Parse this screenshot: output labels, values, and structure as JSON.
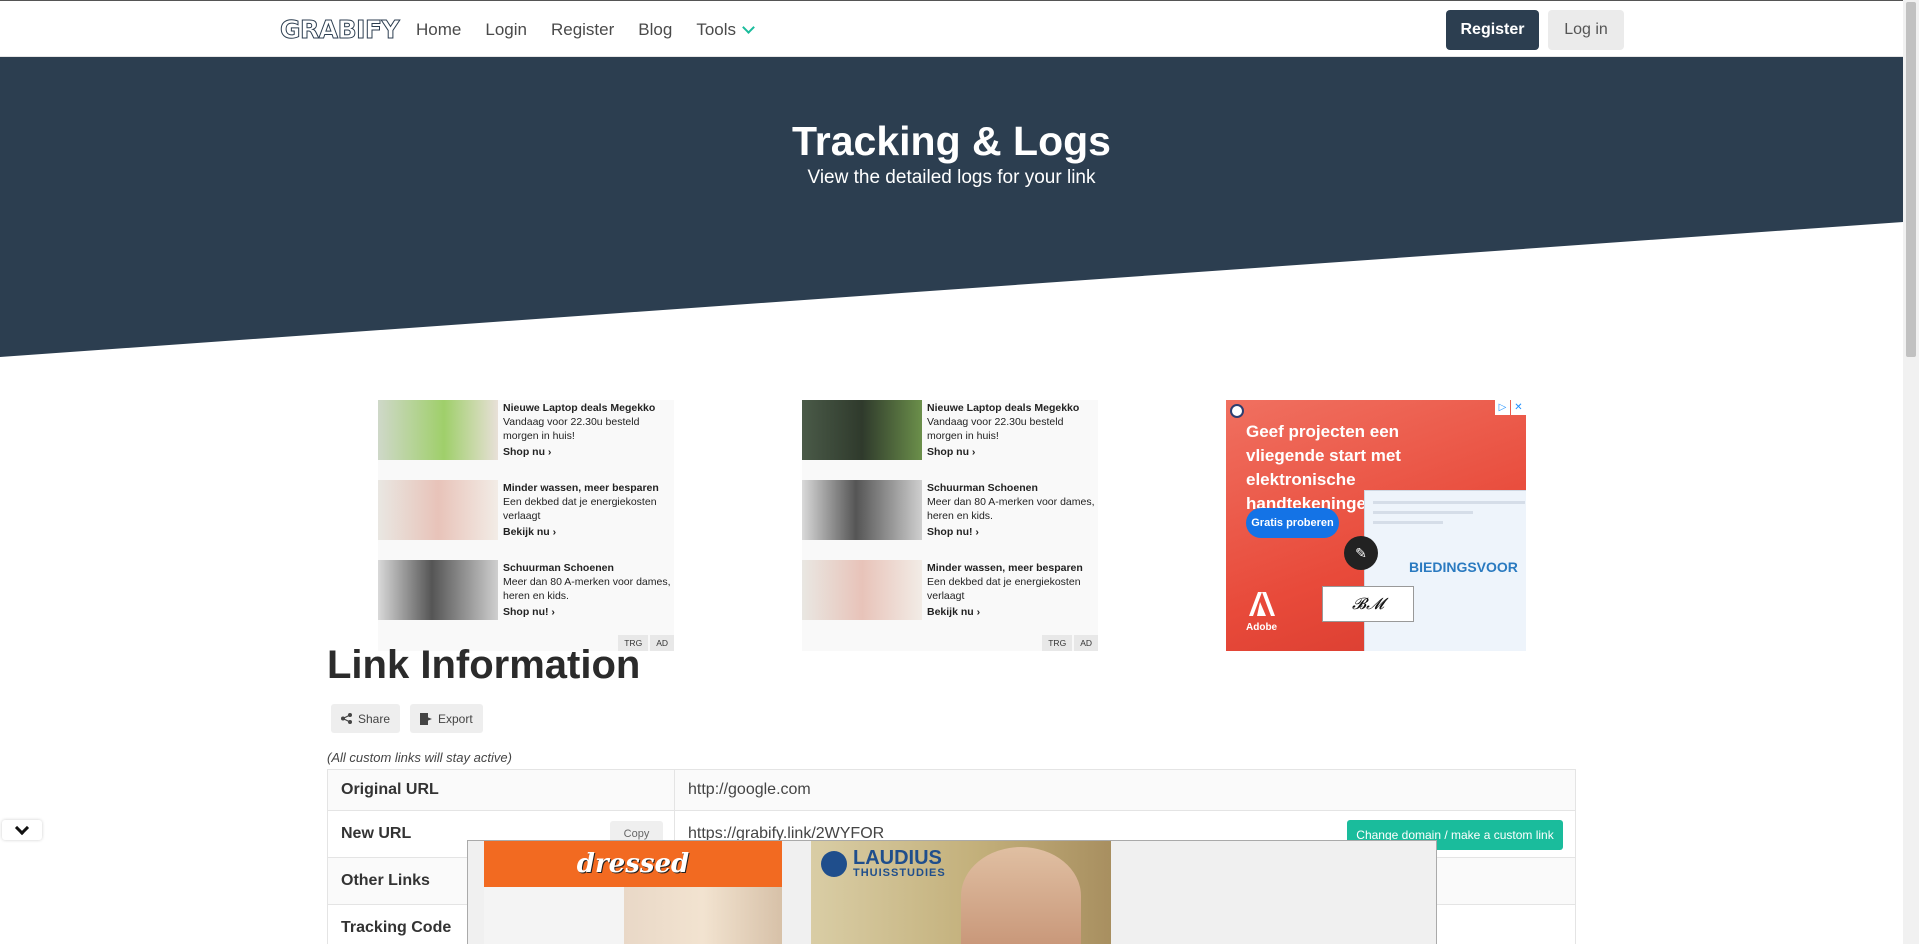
{
  "nav": {
    "logo": "GRABIFY",
    "links": [
      "Home",
      "Login",
      "Register",
      "Blog",
      "Tools"
    ],
    "register_btn": "Register",
    "login_btn": "Log in"
  },
  "hero": {
    "title": "Tracking & Logs",
    "subtitle": "View the detailed logs for your link",
    "bg_color": "#2c3e50"
  },
  "ads": {
    "native_left": {
      "items": [
        {
          "title": "Nieuwe Laptop deals Megekko",
          "desc": "Vandaag voor 22.30u besteld morgen in huis!",
          "cta": "Shop nu"
        },
        {
          "title": "Minder wassen, meer besparen",
          "desc": "Een dekbed dat je energiekosten verlaagt",
          "cta": "Bekijk nu"
        },
        {
          "title": "Schuurman Schoenen",
          "desc": "Meer dan 80 A-merken voor dames, heren en kids.",
          "cta": "Shop nu!"
        }
      ],
      "tags": [
        "TRG",
        "AD"
      ]
    },
    "native_middle": {
      "items": [
        {
          "title": "Nieuwe Laptop deals Megekko",
          "desc": "Vandaag voor 22.30u besteld morgen in huis!",
          "cta": "Shop nu"
        },
        {
          "title": "Schuurman Schoenen",
          "desc": "Meer dan 80 A-merken voor dames, heren en kids.",
          "cta": "Shop nu!"
        },
        {
          "title": "Minder wassen, meer besparen",
          "desc": "Een dekbed dat je energiekosten verlaagt",
          "cta": "Bekijk nu"
        }
      ],
      "tags": [
        "TRG",
        "AD"
      ]
    },
    "adobe": {
      "headline": "Geef projecten een vliegende start met elektronische handtekeningen.",
      "button": "Gratis proberen",
      "doc_word": "BIEDINGSVOOR",
      "brand": "Adobe"
    },
    "sticky": {
      "ad1_brand": "dressed",
      "ad2_brand": "LAUDIUS",
      "ad2_sub": "THUISSTUDIES"
    }
  },
  "link_info": {
    "title": "Link Information",
    "share_btn": "Share",
    "export_btn": "Export",
    "note": "(All custom links will stay active)",
    "rows": [
      {
        "label": "Original URL",
        "value": "http://google.com"
      },
      {
        "label": "New URL",
        "value": "https://grabify.link/2WYFOR",
        "copy": "Copy",
        "action": "Change domain / make a custom link"
      },
      {
        "label": "Other Links",
        "value": ""
      },
      {
        "label": "Tracking Code",
        "value": ""
      }
    ]
  },
  "colors": {
    "accent": "#1abc9c",
    "dark": "#2c3e50"
  }
}
